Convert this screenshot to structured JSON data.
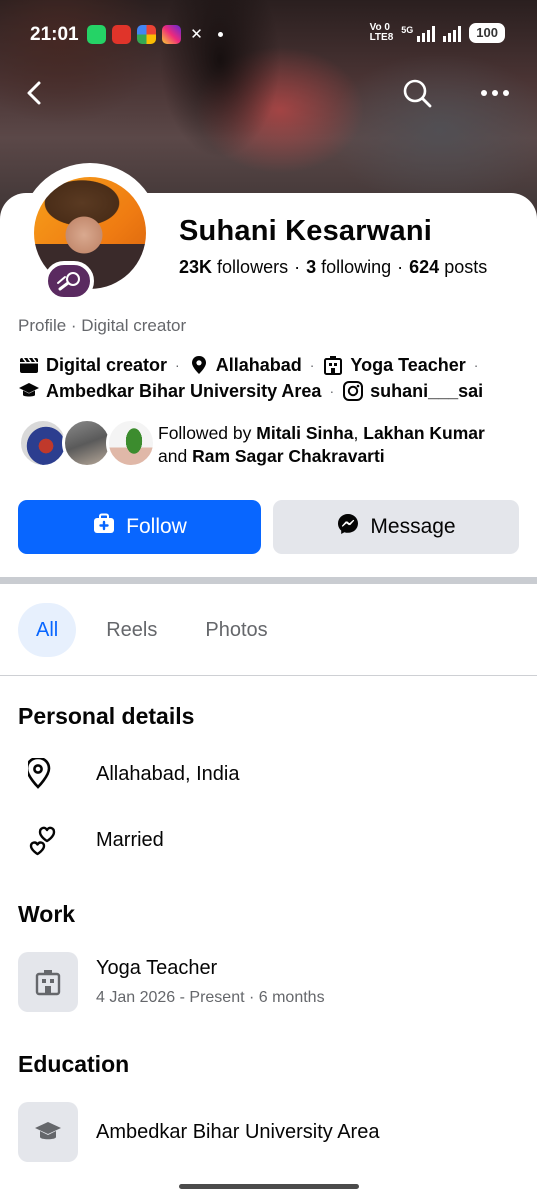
{
  "status_bar": {
    "time": "21:01",
    "network_line1": "Vo 0",
    "network_line2": "LTE8",
    "network_5g": "5G",
    "battery": "100",
    "apps": [
      "whatsapp-icon",
      "maps-icon",
      "photos-icon",
      "instagram-icon",
      "x-icon"
    ]
  },
  "profile": {
    "name": "Suhani Kesarwani",
    "followers_count": "23K",
    "followers_label": "followers",
    "following_count": "3",
    "following_label": "following",
    "posts_count": "624",
    "posts_label": "posts",
    "category_line": "Profile · Digital creator",
    "info": {
      "creator": "Digital creator",
      "location": "Allahabad",
      "job": "Yoga Teacher",
      "school": "Ambedkar Bihar University Area",
      "instagram": "suhani___sai"
    },
    "followed_by_prefix": "Followed by",
    "followed_by_1": "Mitali Sinha",
    "followed_by_sep": ",",
    "followed_by_2": "Lakhan Kumar",
    "followed_by_and": "and",
    "followed_by_3": "Ram Sagar Chakravarti"
  },
  "actions": {
    "follow_label": "Follow",
    "message_label": "Message"
  },
  "tabs": [
    {
      "label": "All",
      "active": true
    },
    {
      "label": "Reels",
      "active": false
    },
    {
      "label": "Photos",
      "active": false
    }
  ],
  "personal_details": {
    "title": "Personal details",
    "location": "Allahabad, India",
    "relationship": "Married"
  },
  "work": {
    "title": "Work",
    "job_title": "Yoga Teacher",
    "duration": "4 Jan 2026 - Present · 6 months"
  },
  "education": {
    "title": "Education",
    "school": "Ambedkar Bihar University Area"
  },
  "colors": {
    "brand_blue": "#0866ff",
    "secondary_button": "#e4e6eb",
    "muted_text": "#65676b"
  }
}
